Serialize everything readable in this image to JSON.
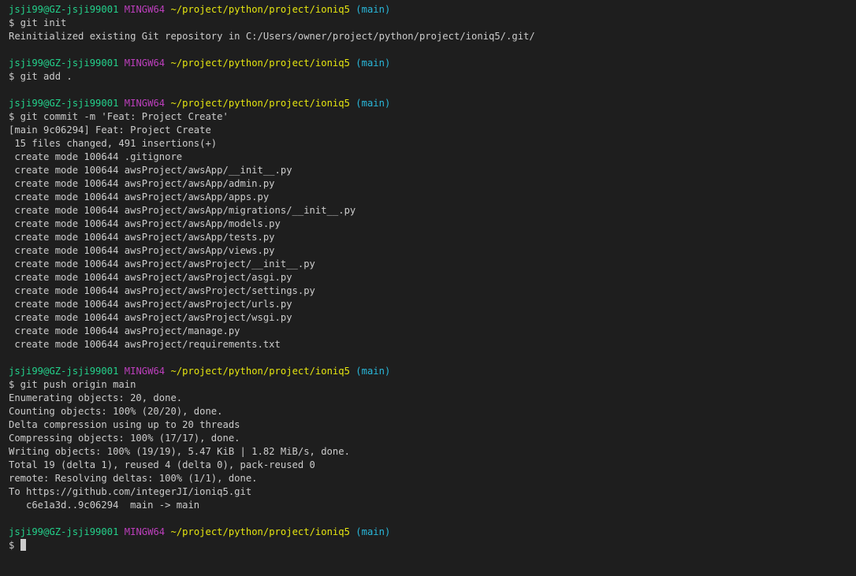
{
  "colors": {
    "background": "#1e1e1e",
    "text": "#cccccc",
    "user": "#23d18b",
    "system": "#bc3fbc",
    "path": "#e5e510",
    "branch": "#29b8db"
  },
  "prompt": {
    "user_host": "jsji99@GZ-jsji99001",
    "system": "MINGW64",
    "path": "~/project/python/project/ioniq5",
    "branch": "(main)"
  },
  "blocks": [
    {
      "command": "$ git init",
      "output": [
        "Reinitialized existing Git repository in C:/Users/owner/project/python/project/ioniq5/.git/"
      ]
    },
    {
      "command": "$ git add .",
      "output": []
    },
    {
      "command": "$ git commit -m 'Feat: Project Create'",
      "output": [
        "[main 9c06294] Feat: Project Create",
        " 15 files changed, 491 insertions(+)",
        " create mode 100644 .gitignore",
        " create mode 100644 awsProject/awsApp/__init__.py",
        " create mode 100644 awsProject/awsApp/admin.py",
        " create mode 100644 awsProject/awsApp/apps.py",
        " create mode 100644 awsProject/awsApp/migrations/__init__.py",
        " create mode 100644 awsProject/awsApp/models.py",
        " create mode 100644 awsProject/awsApp/tests.py",
        " create mode 100644 awsProject/awsApp/views.py",
        " create mode 100644 awsProject/awsProject/__init__.py",
        " create mode 100644 awsProject/awsProject/asgi.py",
        " create mode 100644 awsProject/awsProject/settings.py",
        " create mode 100644 awsProject/awsProject/urls.py",
        " create mode 100644 awsProject/awsProject/wsgi.py",
        " create mode 100644 awsProject/manage.py",
        " create mode 100644 awsProject/requirements.txt"
      ]
    },
    {
      "command": "$ git push origin main",
      "output": [
        "Enumerating objects: 20, done.",
        "Counting objects: 100% (20/20), done.",
        "Delta compression using up to 20 threads",
        "Compressing objects: 100% (17/17), done.",
        "Writing objects: 100% (19/19), 5.47 KiB | 1.82 MiB/s, done.",
        "Total 19 (delta 1), reused 4 (delta 0), pack-reused 0",
        "remote: Resolving deltas: 100% (1/1), done.",
        "To https://github.com/integerJI/ioniq5.git",
        "   c6e1a3d..9c06294  main -> main"
      ]
    }
  ],
  "current_input": "$ "
}
